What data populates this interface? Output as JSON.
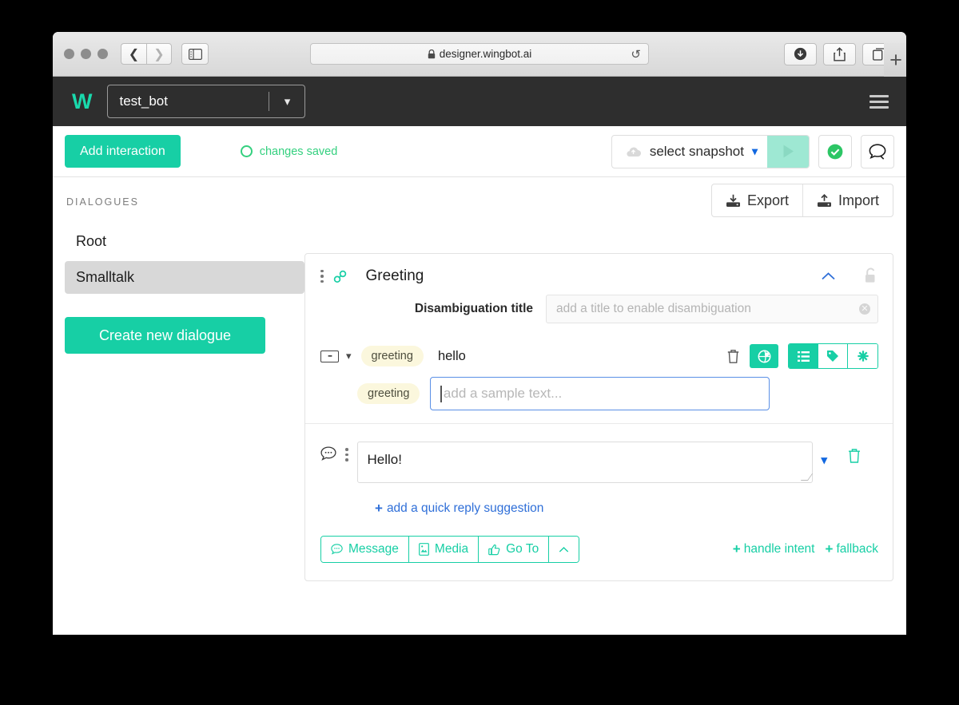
{
  "browser": {
    "url": "designer.wingbot.ai",
    "lock_icon": "lock-icon",
    "reload_icon": "reload-icon",
    "back_icon": "back-arrow-icon",
    "forward_icon": "forward-arrow-icon",
    "sidebar_icon": "sidebar-toggle-icon",
    "download_icon": "download-icon",
    "share_icon": "share-icon",
    "tabs_icon": "tab-overview-icon",
    "new_tab_label": "+"
  },
  "appbar": {
    "logo": "W",
    "bot_name": "test_bot",
    "bot_chevron": "chevron-down-icon",
    "menu_icon": "hamburger-menu-icon"
  },
  "toolbar": {
    "add_interaction_label": "Add interaction",
    "status_text": "changes saved",
    "snapshot_label": "select snapshot",
    "snapshot_cloud_icon": "cloud-upload-icon",
    "snapshot_chevron": "chevron-down-icon",
    "play_icon": "play-icon",
    "check_icon": "check-circle-icon",
    "chat_icon": "speech-bubble-icon"
  },
  "sidebar": {
    "heading": "DIALOGUES",
    "items": [
      {
        "label": "Root",
        "selected": false
      },
      {
        "label": "Smalltalk",
        "selected": true
      }
    ],
    "create_label": "Create new dialogue"
  },
  "main": {
    "export_label": "Export",
    "import_label": "Import",
    "export_icon": "download-icon",
    "import_icon": "upload-icon"
  },
  "card": {
    "drag_icon": "drag-handle-icon",
    "link_icon": "link-icon",
    "title": "Greeting",
    "collapse_icon": "chevron-up-icon",
    "lock_icon": "unlock-icon",
    "disambiguation_label": "Disambiguation title",
    "disambiguation_placeholder": "add a title to enable disambiguation",
    "clear_icon": "clear-circle-icon",
    "samples": [
      {
        "keyboard_icon": "keyboard-icon",
        "expand_icon": "chevron-down-icon",
        "tag": "greeting",
        "text": "hello",
        "delete_icon": "trash-icon",
        "buttons": [
          {
            "name": "location-button",
            "icon": "globe-pin-icon",
            "active": true
          },
          {
            "name": "list-button",
            "icon": "list-icon",
            "active": true
          },
          {
            "name": "tag-button",
            "icon": "tag-icon",
            "active": false
          },
          {
            "name": "wildcard-button",
            "icon": "asterisk-icon",
            "active": false
          }
        ]
      }
    ],
    "new_sample": {
      "tag": "greeting",
      "placeholder": "add a sample text..."
    },
    "message": {
      "bubble_icon": "speech-bubble-icon",
      "drag_icon": "drag-handle-icon",
      "text": "Hello!",
      "expand_icon": "chevron-down-icon",
      "delete_icon": "trash-icon",
      "quick_reply_label": "add a quick reply suggestion",
      "quick_reply_plus": "+"
    },
    "actions": {
      "buttons": [
        {
          "label": "Message",
          "icon": "speech-bubble-icon"
        },
        {
          "label": "Media",
          "icon": "image-icon"
        },
        {
          "label": "Go To",
          "icon": "thumbs-up-icon"
        }
      ],
      "more_icon": "chevron-up-icon",
      "handle_intent_label": "handle intent",
      "fallback_label": "fallback",
      "plus": "+"
    }
  },
  "colors": {
    "accent_teal": "#17cfa5",
    "accent_blue": "#1268e0",
    "status_green": "#34d07f",
    "header_dark": "#2e2e2e",
    "tag_yellow": "#fbf7dd"
  }
}
